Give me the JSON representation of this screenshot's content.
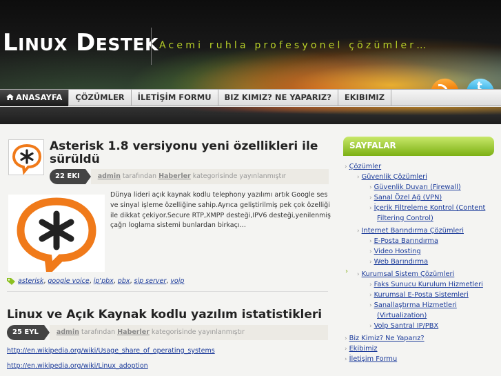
{
  "header": {
    "logo_first": "Linux",
    "logo_second": "Destek",
    "tagline": "Acemi ruhla profesyonel çözümler…"
  },
  "nav": {
    "items": [
      {
        "label": "ANASAYFA",
        "active": true
      },
      {
        "label": "ÇÖZÜMLER"
      },
      {
        "label": "İLETİŞİM FORMU"
      },
      {
        "label": "BIZ KIMIZ? NE YAPARIZ?"
      },
      {
        "label": "EKIBIMIZ"
      }
    ]
  },
  "posts": [
    {
      "title": "Asterisk 1.8 versiyonu yeni özellikleri ile sürüldü",
      "date": "22 EKI",
      "author": "admin",
      "by_text": "tarafından",
      "category": "Haberler",
      "category_suffix": "kategorisinde yayınlanmıştır",
      "excerpt": "Dünya lideri açık kaynak kodlu telephony yazılımı artık Google ses ve sinyal işleme özelliğine sahip.Ayrıca geliştirilmiş  pek çok özelliği ile dikkat çekiyor.Secure RTP,XMPP desteği,IPV6 desteği,yenilenmiş çağrı loglama sistemi bunlardan birkaçı…",
      "tags": [
        "asterisk",
        "google voice",
        "ip'pbx",
        "pbx",
        "sip server",
        "voip"
      ]
    },
    {
      "title": "Linux ve Açık Kaynak kodlu yazılım istatistikleri",
      "date": "25 EYL",
      "author": "admin",
      "by_text": "tarafından",
      "category": "Haberler",
      "category_suffix": "kategorisinde yayınlanmıştır",
      "links": [
        "http://en.wikipedia.org/wiki/Usage_share_of_operating_systems",
        "http://en.wikipedia.org/wiki/Linux_adoption"
      ]
    }
  ],
  "sidebar": {
    "heading": "SAYFALAR",
    "items": [
      "Çözümler",
      "Güvenlik Çözümleri",
      "Güvenlik Duvarı (Firewall)",
      "Sanal Özel Ağ (VPN)",
      "İçerik Filtreleme Kontrol (Content",
      "Filtering Control)",
      "Internet Barındırma Çözümleri",
      "E-Posta Barındırma",
      "Video Hosting",
      "Web Barındırma",
      "Kurumsal Sistem Çözümleri",
      "Faks Sunucu Kurulum Hizmetleri",
      "Kurumsal E-Posta Sistemleri",
      "Sanallaştırma Hizmetleri",
      "(Virtualization)",
      "Volp Santral IP/PBX",
      "Biz Kimiz? Ne Yaparız?",
      "Ekibimiz",
      "İletişim Formu"
    ]
  },
  "colors": {
    "accent_green": "#8cc020",
    "tagline": "#b8d028",
    "link": "#1a3a9a",
    "asterisk_orange": "#f07a1a"
  }
}
